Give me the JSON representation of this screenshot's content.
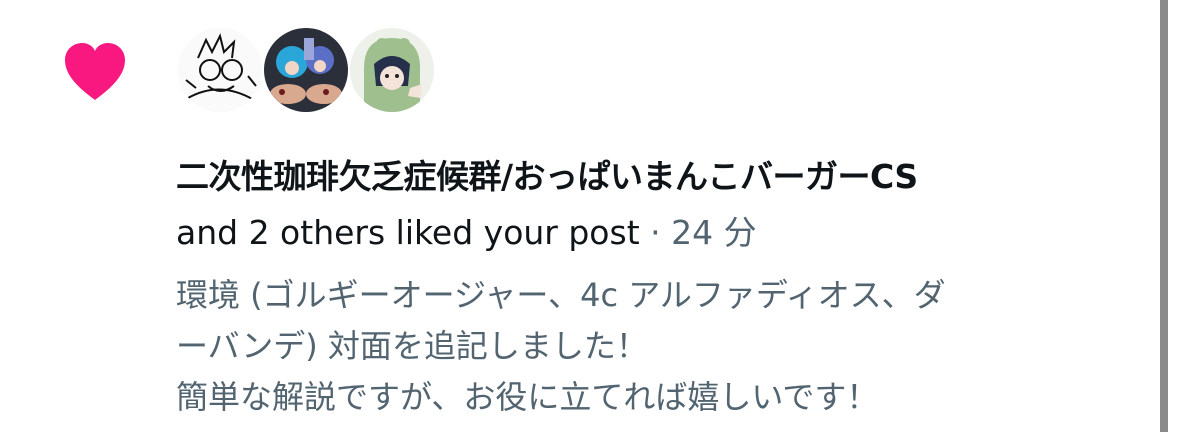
{
  "notification": {
    "icon": "heart-icon",
    "icon_color": "#f91880",
    "avatars": [
      "avatar-sketch",
      "avatar-blue-hair",
      "avatar-green-hood"
    ],
    "actor_name": "二次性珈琲欠乏症候群/おっぱいまんこバーガーCS",
    "action_text": "and 2 others liked your post",
    "separator": "·",
    "time": "24 分",
    "post_excerpt": [
      "環境 (ゴルギーオージャー、4c アルファディオス、ダ",
      "ーバンデ) 対面を追記しました！",
      "簡単な解説ですが、お役に立てれば嬉しいです！"
    ]
  }
}
